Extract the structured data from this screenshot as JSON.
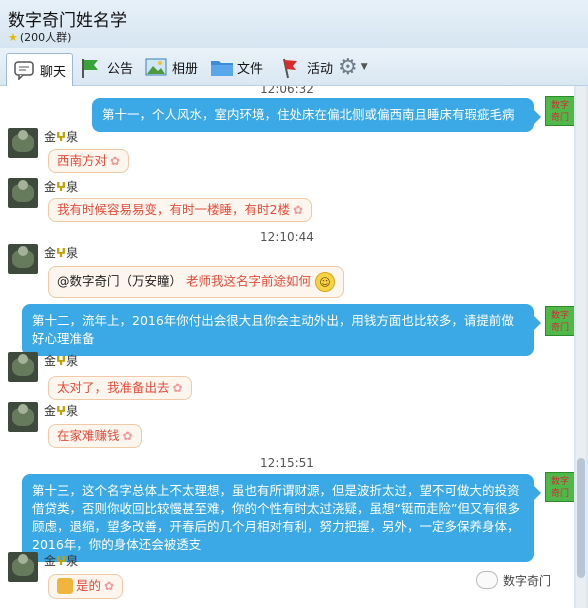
{
  "window": {
    "title": "数字奇门姓名学",
    "subtitle": "(200人群)"
  },
  "toolbar": {
    "chat": "聊天",
    "announce": "公告",
    "album": "相册",
    "files": "文件",
    "activity": "活动"
  },
  "messages": {
    "partial_time": "12:06:32",
    "m1": "第十一，个人风水，室内环境，住处床在偏北侧或偏西南且睡床有瑕疵毛病",
    "avatar_label_line1": "数字",
    "avatar_label_line2": "奇门",
    "sender_name_prefix": "金",
    "sender_name_suffix": "泉",
    "r1": "西南方对",
    "r2": "我有时候容易易变，有时一楼睡，有时2楼",
    "time1": "12:10:44",
    "r3_mention": "@数字奇门（万安瞳）",
    "r3_text": "老师我这名字前途如何",
    "m2": "第十二，流年上，2016年你付出会很大且你会主动外出，用钱方面也比较多，请提前做好心理准备",
    "r4": "太对了，我准备出去",
    "r5": "在家难赚钱",
    "time2": "12:15:51",
    "m3": "第十三，这个名字总体上不太理想，虽也有所谓财源，但是波折太过，望不可做大的投资借贷类，否则你收回比较慢甚至难，你的个性有时太过浇疑，虽想“铤而走险”但又有很多顾虑，退缩，望多改善，开春后的几个月相对有利，努力把握，另外，一定多保养身体，2016年，你的身体还会被透支",
    "r6": "是的"
  },
  "watermark": "数字奇门",
  "colors": {
    "bubble_blue": "#3aa9e5",
    "reply_text": "#e24c3b",
    "avatar_green": "#4fb848"
  }
}
